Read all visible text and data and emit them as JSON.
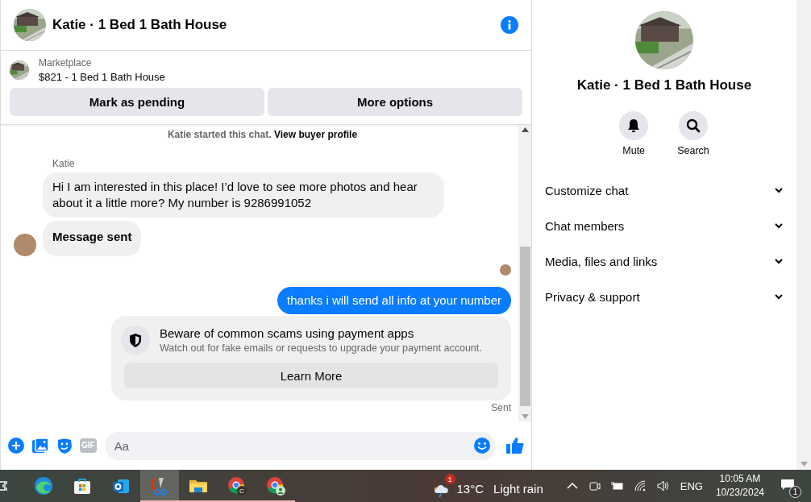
{
  "header": {
    "title": "Katie · 1 Bed 1 Bath House"
  },
  "listing": {
    "source": "Marketplace",
    "price_title": "$821 - 1 Bed 1 Bath House",
    "buttons": [
      "Mark as pending",
      "More options"
    ]
  },
  "messages": [
    {
      "kind": "system",
      "text": "Katie started this chat.",
      "link": "View buyer profile"
    },
    {
      "kind": "sender",
      "text": "Katie"
    },
    {
      "kind": "incoming",
      "text": "Hi I am interested in this place! I’d love to see more photos and hear about it a little more? My number is 9286991052",
      "show_avatar": false,
      "bold": false
    },
    {
      "kind": "incoming",
      "text": "Message sent",
      "show_avatar": true,
      "bold": true
    },
    {
      "kind": "seen"
    },
    {
      "kind": "outgoing",
      "text": "thanks i will send all info at your number"
    },
    {
      "kind": "notice",
      "title": "Beware of common scams using payment apps",
      "text": "Watch out for fake emails or requests to upgrade your payment account.",
      "button": "Learn More"
    },
    {
      "kind": "status",
      "text": "Sent"
    }
  ],
  "composer": {
    "gif_label": "GIF",
    "placeholder": "Aa"
  },
  "details": {
    "title": "Katie · 1 Bed 1 Bath House",
    "actions": [
      {
        "kind": "mute",
        "label": "Mute"
      },
      {
        "kind": "search",
        "label": "Search"
      }
    ],
    "sections": [
      {
        "label": "Customize chat",
        "expanded": false
      },
      {
        "label": "Chat members",
        "expanded": false
      },
      {
        "label": "Media, files and links",
        "expanded": false
      },
      {
        "label": "Privacy & support",
        "expanded": false
      }
    ]
  },
  "taskbar": {
    "apps": [
      {
        "kind": "edge",
        "running": false,
        "selected": false
      },
      {
        "kind": "store",
        "running": false,
        "selected": false
      },
      {
        "kind": "mail",
        "running": false,
        "selected": false
      },
      {
        "kind": "snip",
        "running": true,
        "selected": true
      },
      {
        "kind": "folder",
        "running": true,
        "selected": false
      },
      {
        "kind": "chrome",
        "badge": "C",
        "running": true,
        "selected": false
      },
      {
        "kind": "chrome",
        "running": true,
        "selected": false
      }
    ],
    "weather": {
      "badge": "1",
      "temperature": "13°C",
      "condition": "Light rain"
    },
    "language": "ENG",
    "time": "10:05 AM",
    "date": "10/23/2024",
    "notifications": "1"
  }
}
